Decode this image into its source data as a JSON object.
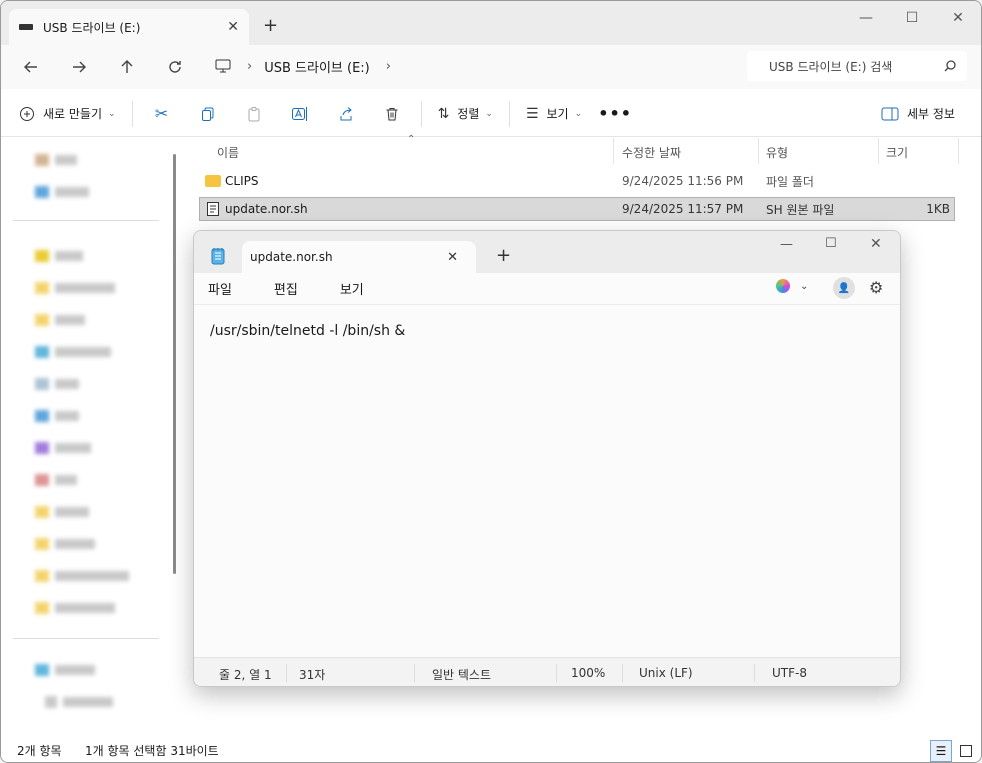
{
  "explorer": {
    "tab_title": "USB 드라이브 (E:)",
    "path": [
      "USB 드라이브 (E:)"
    ],
    "search_placeholder": "USB 드라이브 (E:) 검색",
    "command": {
      "new": "새로 만들기",
      "sort": "정렬",
      "view": "보기",
      "details": "세부 정보"
    },
    "columns": [
      "이름",
      "수정한 날짜",
      "유형",
      "크기"
    ],
    "files": [
      {
        "name": "CLIPS",
        "date": "9/24/2025 11:56 PM",
        "type": "파일 폴더",
        "size": "",
        "icon": "folder-icon"
      },
      {
        "name": "update.nor.sh",
        "date": "9/24/2025 11:57 PM",
        "type": "SH 원본 파일",
        "size": "1KB",
        "icon": "file-icon",
        "selected": true
      }
    ],
    "status_left": "2개 항목",
    "status_sel": "1개 항목 선택함 31바이트"
  },
  "notepad": {
    "tab_title": "update.nor.sh",
    "menu": [
      "파일",
      "편집",
      "보기"
    ],
    "content": "/usr/sbin/telnetd -l /bin/sh &",
    "status": {
      "position": "줄 2, 열 1",
      "chars": "31자",
      "format": "일반 텍스트",
      "zoom": "100%",
      "eol": "Unix (LF)",
      "encoding": "UTF-8"
    }
  },
  "colors": {
    "accent": "#0067c0",
    "folder": "#f5c542"
  }
}
